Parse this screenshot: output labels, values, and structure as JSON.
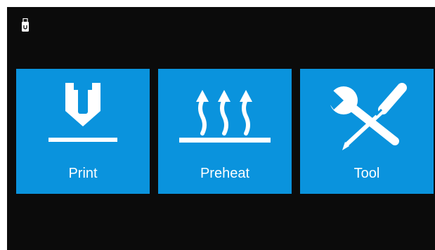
{
  "status_bar": {
    "usb_icon": "usb-drive-icon"
  },
  "menu": {
    "tiles": [
      {
        "label": "Print",
        "icon": "print-nozzle-icon"
      },
      {
        "label": "Preheat",
        "icon": "heat-waves-icon"
      },
      {
        "label": "Tool",
        "icon": "wrench-screwdriver-icon"
      }
    ]
  },
  "colors": {
    "background": "#0b0b0b",
    "tile": "#0a93dd",
    "foreground": "#ffffff"
  }
}
